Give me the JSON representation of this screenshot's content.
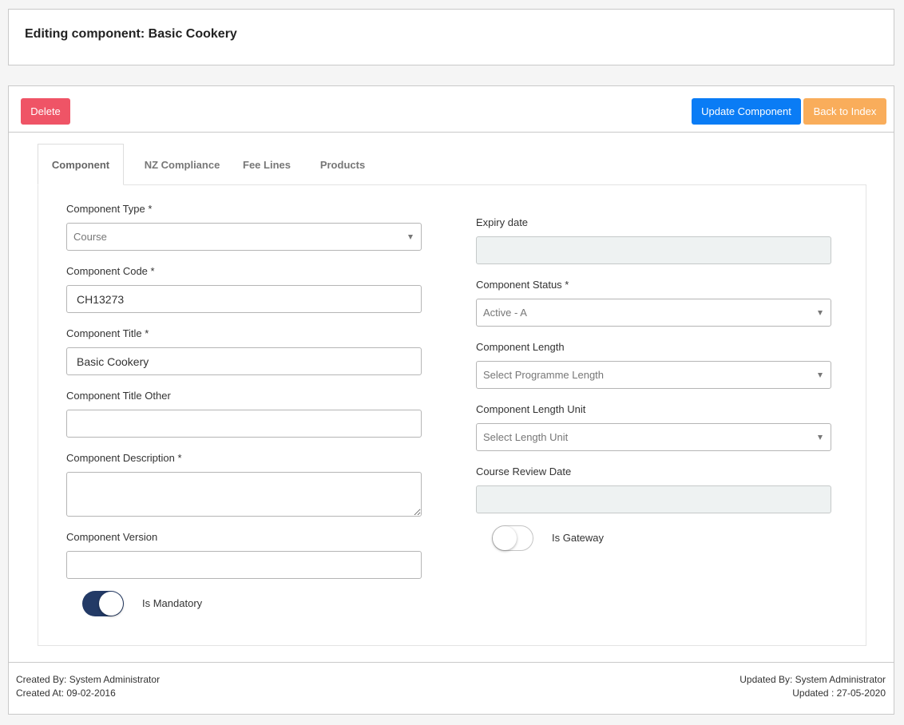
{
  "header": {
    "title": "Editing component: Basic Cookery"
  },
  "toolbar": {
    "delete_label": "Delete",
    "update_label": "Update Component",
    "back_label": "Back to Index"
  },
  "colors": {
    "delete": "#ef5466",
    "update": "#0a7cf5",
    "back": "#f9ad5b",
    "toggle_on": "#233a66"
  },
  "tabs": [
    {
      "label": "Component",
      "active": true
    },
    {
      "label": "NZ Compliance",
      "active": false
    },
    {
      "label": "Fee Lines",
      "active": false
    },
    {
      "label": "Products",
      "active": false
    }
  ],
  "form": {
    "component_type": {
      "label": "Component Type *",
      "value": "Course"
    },
    "component_code": {
      "label": "Component Code *",
      "value": "CH13273"
    },
    "component_title": {
      "label": "Component Title *",
      "value": "Basic Cookery"
    },
    "component_title_other": {
      "label": "Component Title Other",
      "value": ""
    },
    "component_description": {
      "label": "Component Description *",
      "value": ""
    },
    "component_version": {
      "label": "Component Version",
      "value": ""
    },
    "is_mandatory": {
      "label": "Is Mandatory",
      "checked": true
    },
    "expiry_date": {
      "label": "Expiry date",
      "value": ""
    },
    "component_status": {
      "label": "Component Status *",
      "value": "Active - A"
    },
    "component_length": {
      "label": "Component Length",
      "placeholder": "Select Programme Length"
    },
    "component_length_unit": {
      "label": "Component Length Unit",
      "placeholder": "Select Length Unit"
    },
    "course_review_date": {
      "label": "Course Review Date",
      "value": ""
    },
    "is_gateway": {
      "label": "Is Gateway",
      "checked": false
    }
  },
  "footer": {
    "created_by": "Created By: System Administrator",
    "created_at": "Created At: 09-02-2016",
    "updated_by": "Updated By: System Administrator",
    "updated_at": "Updated : 27-05-2020"
  }
}
